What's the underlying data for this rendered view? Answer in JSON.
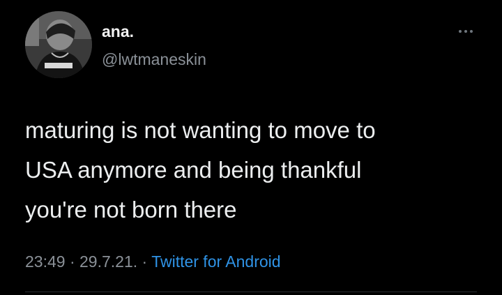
{
  "tweet": {
    "display_name": "ana.",
    "handle": "@lwtmaneskin",
    "text": "maturing is not wanting to move to\nUSA anymore and being thankful\nyou're not born there",
    "time": "23:49",
    "date": "29.7.21.",
    "source": "Twitter for Android",
    "separator": " · "
  },
  "icons": {
    "avatar": "profile-photo",
    "more": "more-options-icon"
  },
  "colors": {
    "background": "#000000",
    "primary_text": "#eceeef",
    "secondary_text": "#8b9198",
    "link": "#2f93e6"
  }
}
